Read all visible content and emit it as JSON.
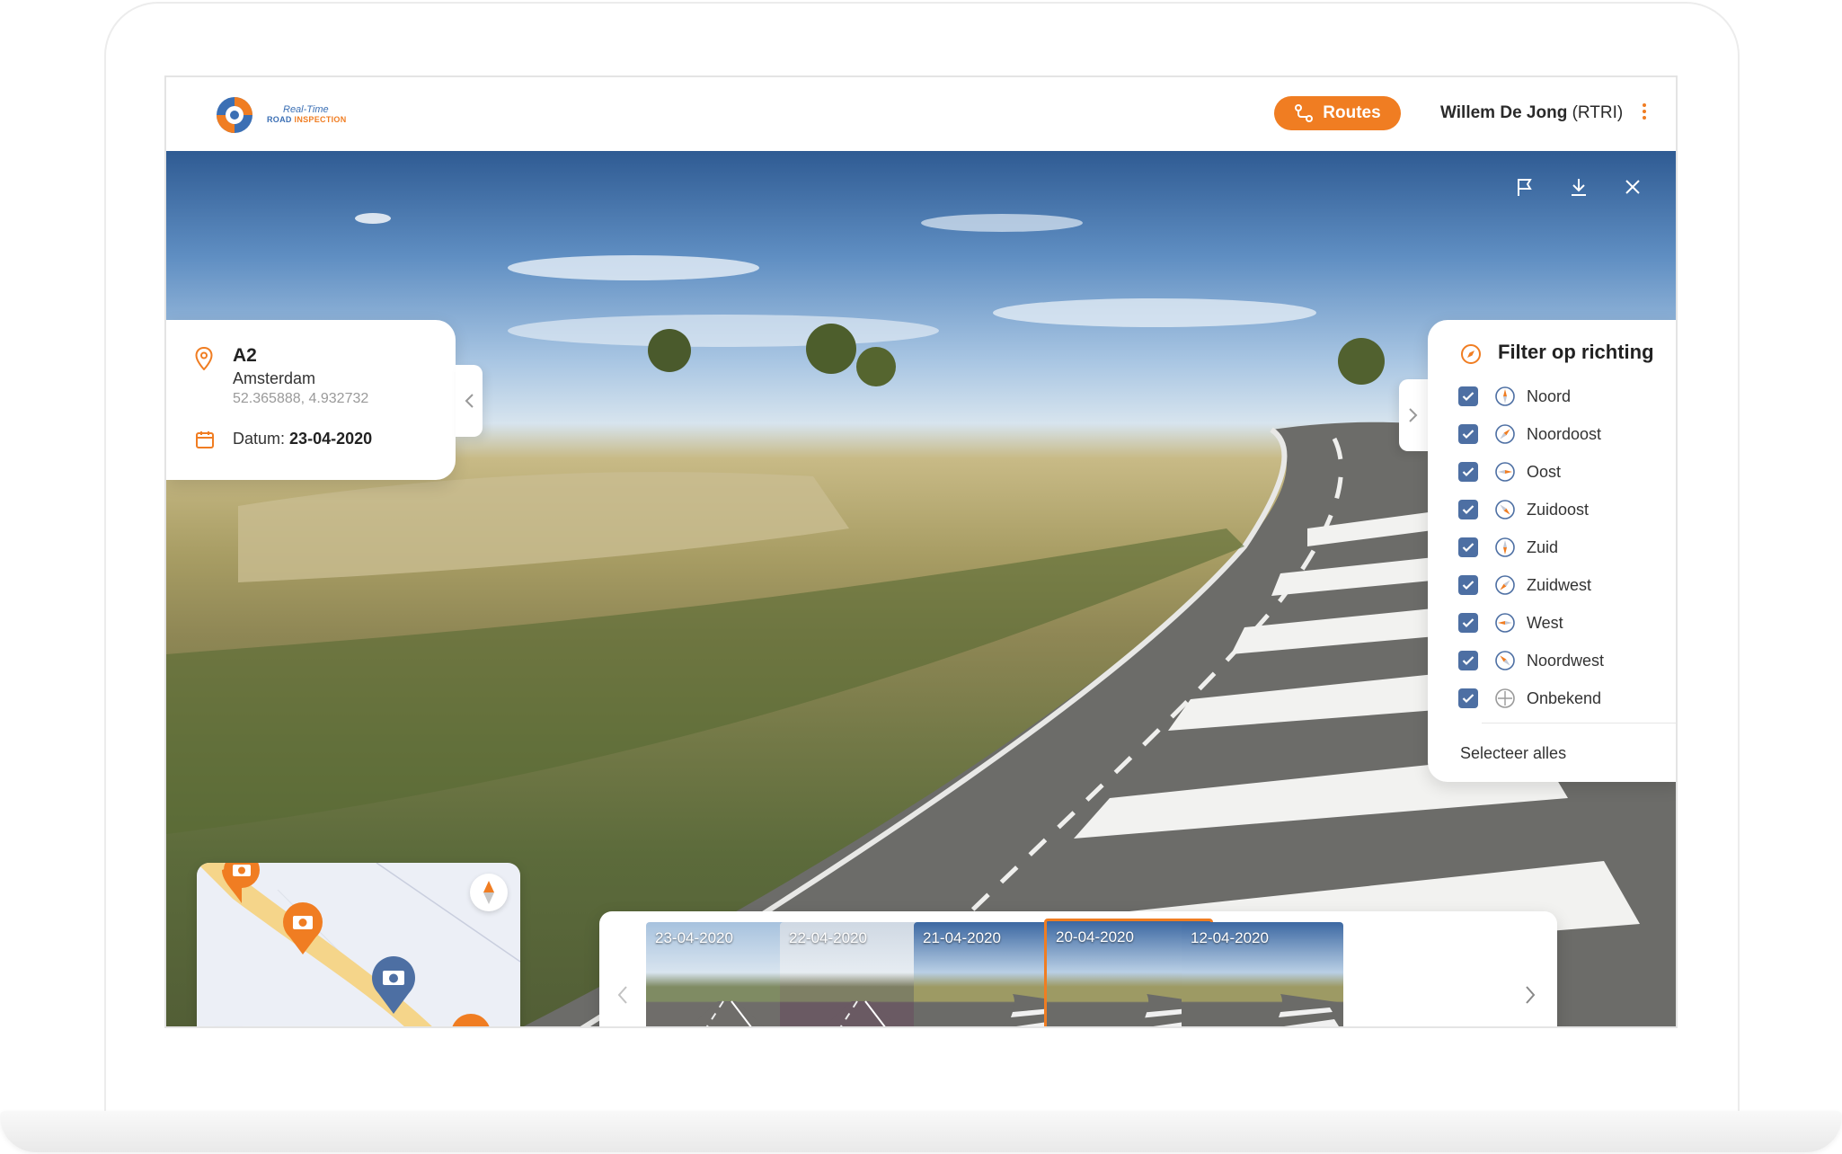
{
  "header": {
    "logo_line1": "Real-Time",
    "logo_line2_a": "ROAD",
    "logo_line2_b": "INSPECTION",
    "routes_label": "Routes",
    "user_name": "Willem De Jong",
    "user_org": "(RTRI)"
  },
  "location": {
    "road": "A2",
    "city": "Amsterdam",
    "coordinates": "52.365888, 4.932732",
    "date_label": "Datum:",
    "date_value": "23-04-2020"
  },
  "filter": {
    "title": "Filter op richting",
    "directions": [
      {
        "label": "Noord",
        "checked": true
      },
      {
        "label": "Noordoost",
        "checked": true
      },
      {
        "label": "Oost",
        "checked": true
      },
      {
        "label": "Zuidoost",
        "checked": true
      },
      {
        "label": "Zuid",
        "checked": true
      },
      {
        "label": "Zuidwest",
        "checked": true
      },
      {
        "label": "West",
        "checked": true
      },
      {
        "label": "Noordwest",
        "checked": true
      },
      {
        "label": "Onbekend",
        "checked": true
      }
    ],
    "select_all_label": "Selecteer alles"
  },
  "thumbnails": [
    {
      "date": "23-04-2020",
      "selected": false,
      "bookmarked": false
    },
    {
      "date": "22-04-2020",
      "selected": false,
      "bookmarked": false
    },
    {
      "date": "21-04-2020",
      "selected": false,
      "bookmarked": false
    },
    {
      "date": "20-04-2020",
      "selected": true,
      "bookmarked": true
    },
    {
      "date": "12-04-2020",
      "selected": false,
      "bookmarked": true
    }
  ],
  "colors": {
    "accent": "#f07d22",
    "checkbox": "#4d6fa3",
    "map_marker_active": "#4d6fa3",
    "map_route": "#f5d58a"
  },
  "icons": [
    "flag-icon",
    "download-icon",
    "close-icon",
    "location-pin-icon",
    "calendar-icon",
    "compass-icon",
    "expand-icon",
    "camera-marker-icon",
    "bookmark-icon"
  ]
}
